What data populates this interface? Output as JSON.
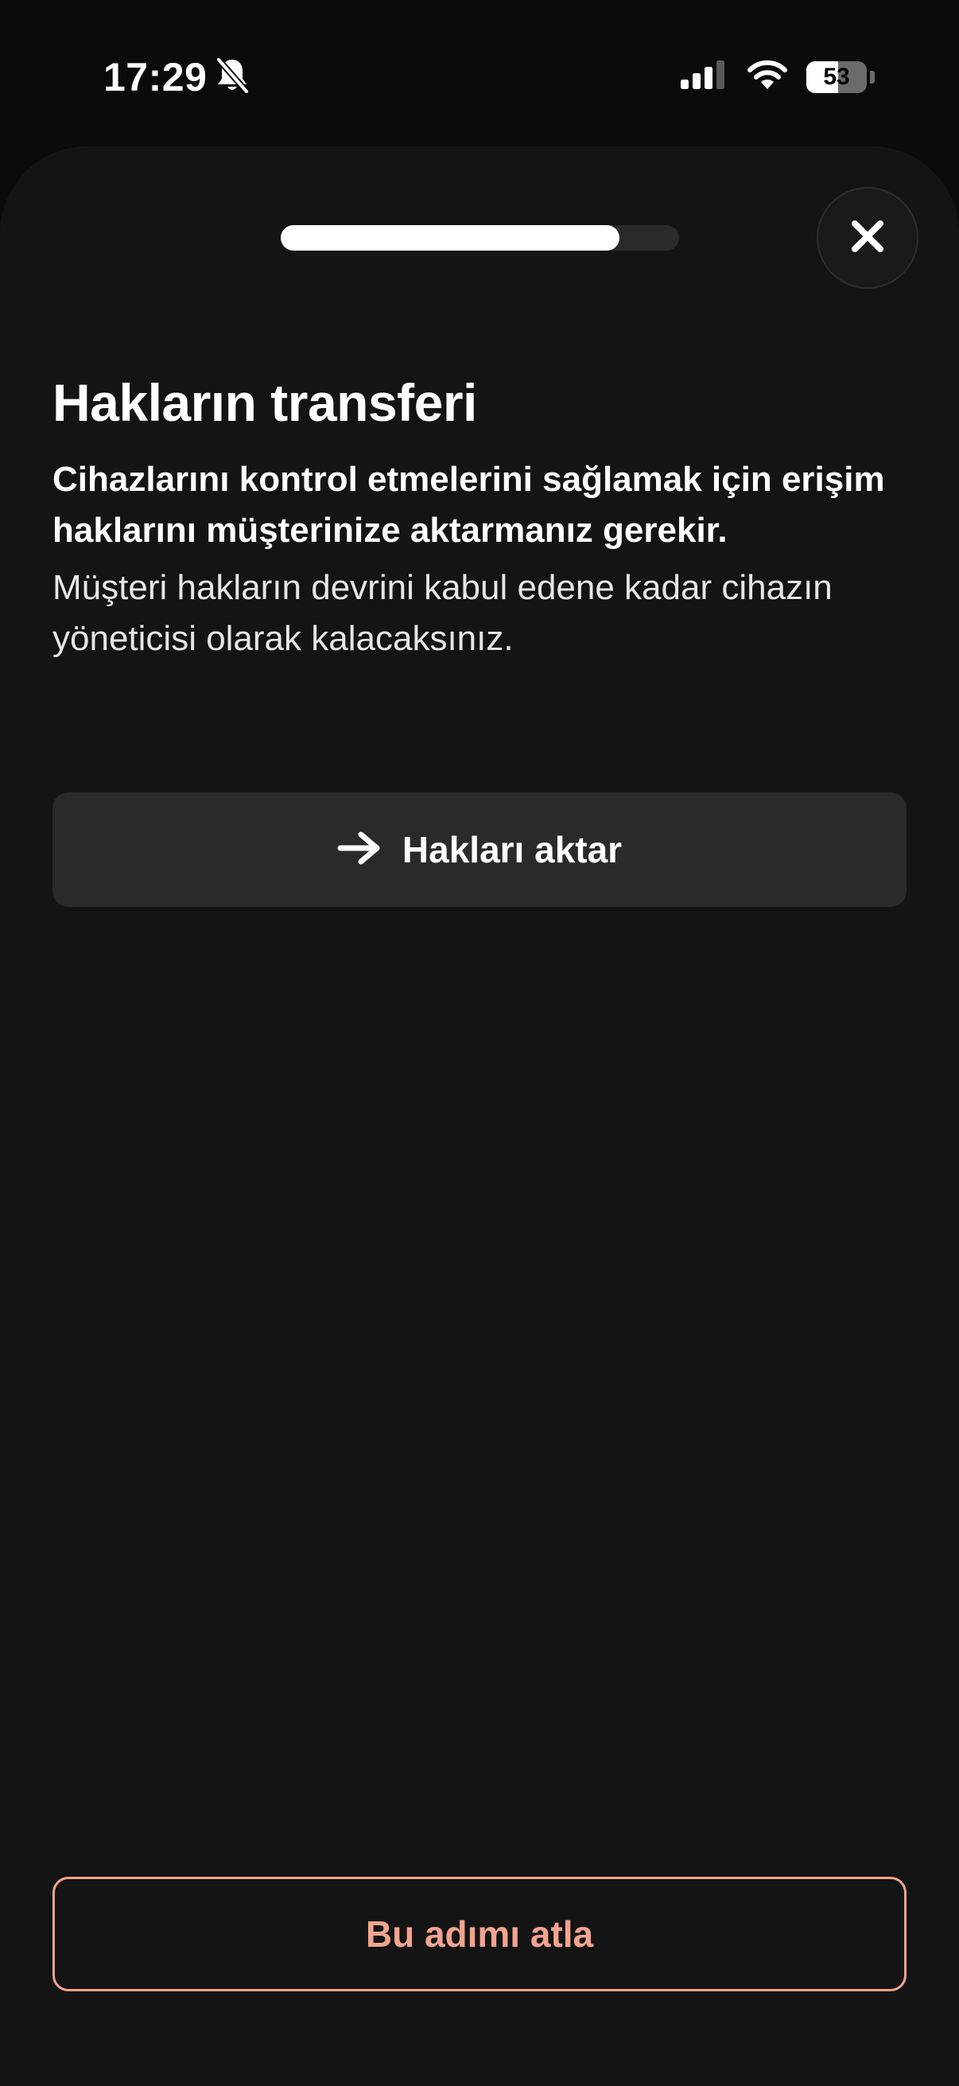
{
  "status_bar": {
    "time": "17:29",
    "battery_percent": "53",
    "battery_level": 0.53,
    "icons": [
      "bell-slash-icon",
      "cellular-signal-icon",
      "wifi-icon",
      "battery-icon"
    ]
  },
  "sheet": {
    "progress": 0.85,
    "close_icon": "close-icon",
    "title": "Hakların transferi",
    "subtitle": "Cihazlarını kontrol etmelerini sağlamak için erişim haklarını müşterinize aktarmanız gerekir.",
    "description": "Müşteri hakların devrini kabul edene kadar cihazın yöneticisi olarak kalacaksınız.",
    "transfer_button": {
      "icon": "arrow-right-icon",
      "label": "Hakları aktar"
    },
    "skip_button": {
      "label": "Bu adımı atla"
    }
  },
  "colors": {
    "background": "#141414",
    "button_surface": "#2a2a2a",
    "accent": "#f2a48f",
    "text": "#ffffff"
  }
}
